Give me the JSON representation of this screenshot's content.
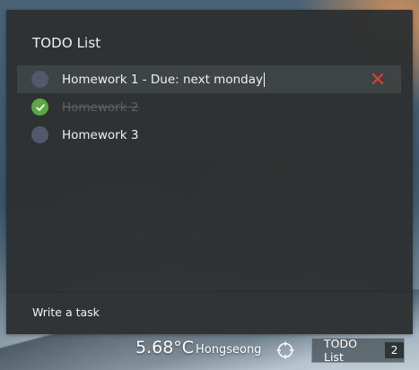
{
  "panel": {
    "title": "TODO List",
    "tasks": [
      {
        "text": "Homework 1 - Due: next monday",
        "completed": false,
        "editing": true
      },
      {
        "text": "Homework 2",
        "completed": true,
        "editing": false
      },
      {
        "text": "Homework 3",
        "completed": false,
        "editing": false
      }
    ],
    "write_label": "Write a task"
  },
  "taskbar": {
    "temperature": "5.68°C",
    "city": "Hongseong",
    "todo_button_label": "TODO List",
    "todo_count": "2"
  },
  "icons": {
    "delete": "close-x-icon",
    "done": "checkmark-icon",
    "locate": "crosshair-icon"
  },
  "colors": {
    "panel_bg": "#2d3132",
    "done_green": "#5aa845",
    "delete_red": "#d9412f",
    "unchecked": "#52596a"
  }
}
